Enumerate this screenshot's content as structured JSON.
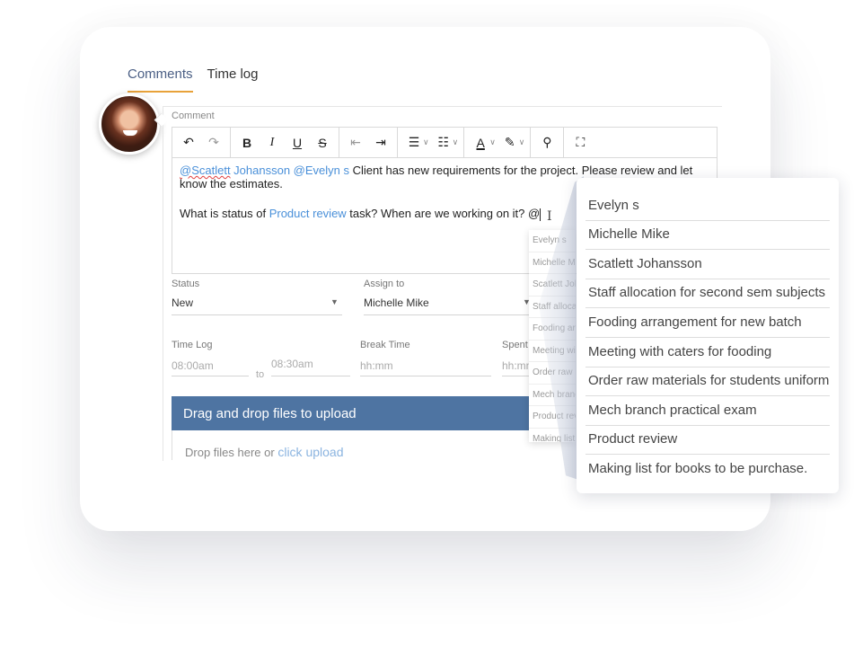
{
  "tabs": [
    {
      "label": "Comments",
      "active": true
    },
    {
      "label": "Time log",
      "active": false
    }
  ],
  "comment": {
    "label": "Comment",
    "toolbar": {
      "undo": "undo-icon",
      "redo": "redo-icon",
      "bold": "B",
      "italic": "I",
      "underline": "U",
      "strike": "S",
      "outdent": "outdent-icon",
      "indent": "indent-icon",
      "ordered_list": "ordered-list-icon",
      "bullet_list": "bullet-list-icon",
      "font_color": "A",
      "highlight": "highlight-icon",
      "stamp": "stamp-icon",
      "fullscreen": "fullscreen-icon"
    },
    "body": {
      "mention1": "@Scatlett",
      "mention1_rest": " Johansson",
      "mention2": " @Evelyn s",
      "line1_text": " Client has new requirements for the project. Please review and let know the estimates.",
      "line2_prefix": "What is status of ",
      "line2_link": "Product review",
      "line2_suffix": " task? When are we working on it? @"
    }
  },
  "form": {
    "status": {
      "label": "Status",
      "value": "New"
    },
    "assign": {
      "label": "Assign to",
      "value": "Michelle Mike"
    },
    "timelog": {
      "label": "Time Log",
      "from": "08:00am",
      "to_label": "to",
      "to": "08:30am"
    },
    "break": {
      "label": "Break Time",
      "placeholder": "hh:mm"
    },
    "spent": {
      "label": "Spent",
      "placeholder": "hh:mm"
    }
  },
  "upload": {
    "title": "Drag and drop files to upload",
    "hint": "Drop files here or ",
    "link": "click upload"
  },
  "mention_menu": {
    "items": [
      "Evelyn s",
      "Michelle Mike",
      "Scatlett Johansson",
      "Staff allocation for second sem subjects",
      "Fooding arrangement for new batch",
      "Meeting with caters for fooding",
      "Order raw materials for students uniform",
      "Mech branch practical exam",
      "Product review",
      "Making list for books to be purchase."
    ]
  },
  "colors": {
    "tab_active": "#4b5f85",
    "tab_underline": "#e8a23a",
    "upload_bar": "#4e74a2",
    "mention": "#4a90d9"
  }
}
